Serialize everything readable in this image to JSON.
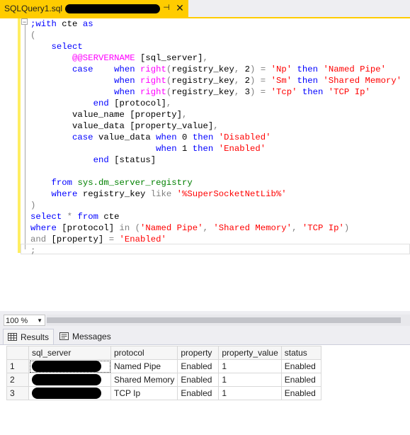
{
  "tab": {
    "title": "SQLQuery1.sql -",
    "pin": "⊣",
    "close": "✕"
  },
  "editor": {
    "lines": [
      [
        [
          "kw",
          ";with"
        ],
        [
          "n",
          " cte "
        ],
        [
          "kw",
          "as"
        ]
      ],
      [
        [
          "gr",
          "("
        ]
      ],
      [
        [
          "n",
          "    "
        ],
        [
          "kw",
          "select"
        ]
      ],
      [
        [
          "n",
          "        "
        ],
        [
          "fn",
          "@@SERVERNAME"
        ],
        [
          "n",
          " [sql_server]"
        ],
        [
          "gr",
          ","
        ]
      ],
      [
        [
          "n",
          "        "
        ],
        [
          "kw",
          "case"
        ],
        [
          "n",
          "    "
        ],
        [
          "kw",
          "when"
        ],
        [
          "n",
          " "
        ],
        [
          "fn",
          "right"
        ],
        [
          "gr",
          "("
        ],
        [
          "n",
          "registry_key"
        ],
        [
          "gr",
          ","
        ],
        [
          "n",
          " 2"
        ],
        [
          "gr",
          ")"
        ],
        [
          "n",
          " "
        ],
        [
          "gr",
          "="
        ],
        [
          "n",
          " "
        ],
        [
          "str",
          "'Np'"
        ],
        [
          "n",
          " "
        ],
        [
          "kw",
          "then"
        ],
        [
          "n",
          " "
        ],
        [
          "str",
          "'Named Pipe'"
        ]
      ],
      [
        [
          "n",
          "                "
        ],
        [
          "kw",
          "when"
        ],
        [
          "n",
          " "
        ],
        [
          "fn",
          "right"
        ],
        [
          "gr",
          "("
        ],
        [
          "n",
          "registry_key"
        ],
        [
          "gr",
          ","
        ],
        [
          "n",
          " 2"
        ],
        [
          "gr",
          ")"
        ],
        [
          "n",
          " "
        ],
        [
          "gr",
          "="
        ],
        [
          "n",
          " "
        ],
        [
          "str",
          "'Sm'"
        ],
        [
          "n",
          " "
        ],
        [
          "kw",
          "then"
        ],
        [
          "n",
          " "
        ],
        [
          "str",
          "'Shared Memory'"
        ]
      ],
      [
        [
          "n",
          "                "
        ],
        [
          "kw",
          "when"
        ],
        [
          "n",
          " "
        ],
        [
          "fn",
          "right"
        ],
        [
          "gr",
          "("
        ],
        [
          "n",
          "registry_key"
        ],
        [
          "gr",
          ","
        ],
        [
          "n",
          " 3"
        ],
        [
          "gr",
          ")"
        ],
        [
          "n",
          " "
        ],
        [
          "gr",
          "="
        ],
        [
          "n",
          " "
        ],
        [
          "str",
          "'Tcp'"
        ],
        [
          "n",
          " "
        ],
        [
          "kw",
          "then"
        ],
        [
          "n",
          " "
        ],
        [
          "str",
          "'TCP Ip'"
        ]
      ],
      [
        [
          "n",
          "            "
        ],
        [
          "kw",
          "end"
        ],
        [
          "n",
          " [protocol]"
        ],
        [
          "gr",
          ","
        ]
      ],
      [
        [
          "n",
          "        value_name [property]"
        ],
        [
          "gr",
          ","
        ]
      ],
      [
        [
          "n",
          "        value_data [property_value]"
        ],
        [
          "gr",
          ","
        ]
      ],
      [
        [
          "n",
          "        "
        ],
        [
          "kw",
          "case"
        ],
        [
          "n",
          " value_data "
        ],
        [
          "kw",
          "when"
        ],
        [
          "n",
          " 0 "
        ],
        [
          "kw",
          "then"
        ],
        [
          "n",
          " "
        ],
        [
          "str",
          "'Disabled'"
        ]
      ],
      [
        [
          "n",
          "                        "
        ],
        [
          "kw",
          "when"
        ],
        [
          "n",
          " 1 "
        ],
        [
          "kw",
          "then"
        ],
        [
          "n",
          " "
        ],
        [
          "str",
          "'Enabled'"
        ]
      ],
      [
        [
          "n",
          "            "
        ],
        [
          "kw",
          "end"
        ],
        [
          "n",
          " [status]"
        ]
      ],
      [
        [
          "n",
          ""
        ]
      ],
      [
        [
          "n",
          "    "
        ],
        [
          "kw",
          "from"
        ],
        [
          "n",
          " "
        ],
        [
          "sy",
          "sys.dm_server_registry"
        ]
      ],
      [
        [
          "n",
          "    "
        ],
        [
          "kw",
          "where"
        ],
        [
          "n",
          " registry_key "
        ],
        [
          "gr",
          "like"
        ],
        [
          "n",
          " "
        ],
        [
          "str",
          "'%SuperSocketNetLib%'"
        ]
      ],
      [
        [
          "gr",
          ")"
        ]
      ],
      [
        [
          "kw",
          "select"
        ],
        [
          "n",
          " "
        ],
        [
          "gr",
          "*"
        ],
        [
          "n",
          " "
        ],
        [
          "kw",
          "from"
        ],
        [
          "n",
          " cte"
        ]
      ],
      [
        [
          "kw",
          "where"
        ],
        [
          "n",
          " [protocol] "
        ],
        [
          "gr",
          "in"
        ],
        [
          "n",
          " "
        ],
        [
          "gr",
          "("
        ],
        [
          "str",
          "'Named Pipe'"
        ],
        [
          "gr",
          ","
        ],
        [
          "n",
          " "
        ],
        [
          "str",
          "'Shared Memory'"
        ],
        [
          "gr",
          ","
        ],
        [
          "n",
          " "
        ],
        [
          "str",
          "'TCP Ip'"
        ],
        [
          "gr",
          ")"
        ]
      ],
      [
        [
          "gr",
          "and"
        ],
        [
          "n",
          " [property] "
        ],
        [
          "gr",
          "="
        ],
        [
          "n",
          " "
        ],
        [
          "str",
          "'Enabled'"
        ]
      ],
      [
        [
          "gr",
          ";"
        ]
      ]
    ]
  },
  "zoom": {
    "value": "100 %"
  },
  "results_tabs": {
    "results": "Results",
    "messages": "Messages"
  },
  "grid": {
    "headers": [
      "sql_server",
      "protocol",
      "property",
      "property_value",
      "status"
    ],
    "rows": [
      {
        "num": "1",
        "protocol": "Named Pipe",
        "property": "Enabled",
        "property_value": "1",
        "status": "Enabled"
      },
      {
        "num": "2",
        "protocol": "Shared Memory",
        "property": "Enabled",
        "property_value": "1",
        "status": "Enabled"
      },
      {
        "num": "3",
        "protocol": "TCP Ip",
        "property": "Enabled",
        "property_value": "1",
        "status": "Enabled"
      }
    ]
  },
  "colors": {
    "keyword": "#0000ff",
    "function": "#ff00ff",
    "string": "#ff0000",
    "operator": "#808080",
    "system": "#008000",
    "tab_accent": "#ffcc00"
  }
}
